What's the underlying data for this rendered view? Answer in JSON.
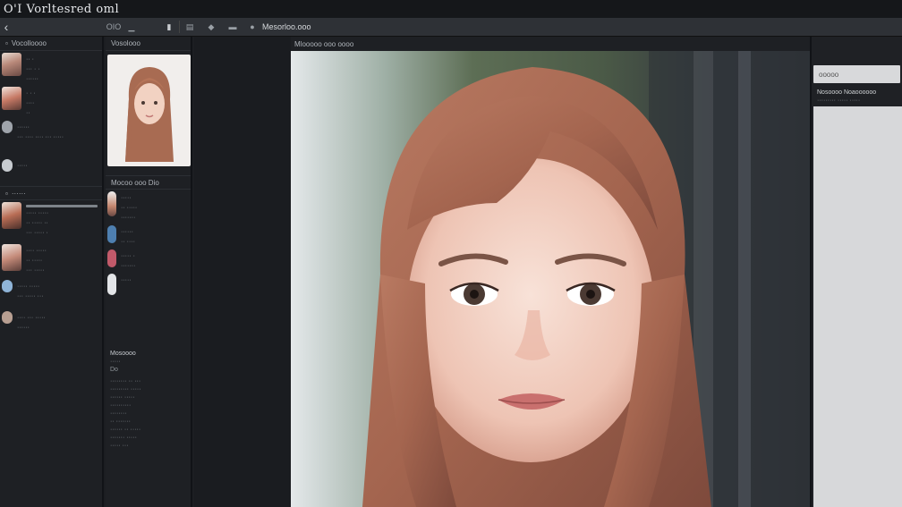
{
  "window": {
    "title": "O'I Vorltesred oml"
  },
  "toolbar": {
    "back_icon": "chevron-left-icon",
    "items": [
      "ΟΙΟ",
      "▁",
      "▮",
      "▤",
      "◆",
      "▬",
      "●"
    ],
    "file_label": "Mesorloo.ooo"
  },
  "left_panel": {
    "header": "Vocolloooo",
    "items": [
      {
        "lines": [
          "·· ·",
          "··· · ·",
          "······"
        ]
      },
      {
        "lines": [
          "· · ·",
          "····",
          "··"
        ]
      },
      {
        "lines": [
          "······",
          "··· ···· ···· ··· ·····",
          ""
        ]
      },
      {
        "lines": [
          "·····"
        ]
      },
      {
        "lines": [
          "····· ·····",
          "·· ····· ··",
          "··· ····· ·"
        ]
      },
      {
        "lines": [
          "···· ·····",
          "·· ·····",
          "··· ·····"
        ]
      },
      {
        "lines": [
          "····· ·····",
          "··· ····· ···"
        ]
      },
      {
        "lines": [
          "···· ··· ·····",
          "······"
        ]
      }
    ],
    "footer_label": "······"
  },
  "mid_panel": {
    "header": "Vosolooo",
    "section_label": "Mocoo  ooo  Dio",
    "items": [
      {
        "lines": [
          "·····",
          "·· ·····",
          "·······"
        ]
      },
      {
        "lines": [
          "······",
          "·· ····"
        ]
      },
      {
        "lines": [
          "····· ·",
          "·······"
        ]
      },
      {
        "lines": [
          "·····"
        ]
      }
    ],
    "props_title": "Mosoooo",
    "props": [
      "·····",
      "Do",
      "········ ·· ···",
      "········· ·····",
      "······ ·····",
      "··········",
      "········",
      "·· ·······",
      "······ ·· ·····",
      "······· ·····",
      "····· ···"
    ]
  },
  "canvas": {
    "header": "Mlooooo ooo oooo"
  },
  "right_panel": {
    "button_label": "ooooo",
    "text_lines": [
      "Nosoooo  Noaoooooo",
      "·········  ·····  ·····"
    ]
  }
}
